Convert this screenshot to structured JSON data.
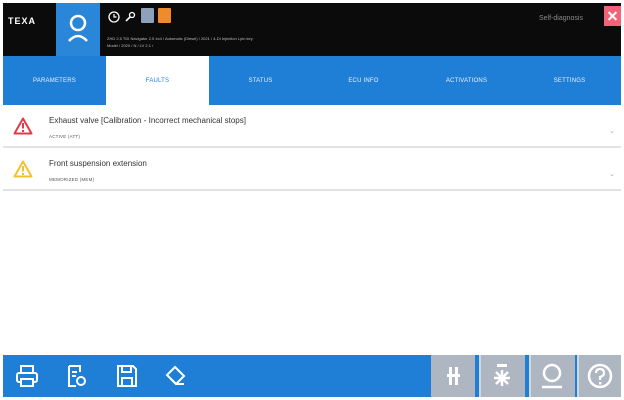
{
  "header": {
    "logo": "TEXA",
    "vehicle_line1": "ZHD 2.5 TDI Navigator 2.5 4x4 / Automatic (Diesel) / 2021 / 4-DI Injection Lpin key",
    "vehicle_line2": "Model / 2020 / N / LV 2.1 /",
    "self_diagnosis": "Self-diagnosis",
    "colors": {
      "bar": "#0b0b0b",
      "accent": "#2a86d9",
      "orange": "#f08a2a",
      "close": "#f2637a"
    }
  },
  "tabs": [
    {
      "label": "PARAMETERS",
      "active": false
    },
    {
      "label": "FAULTS",
      "active": true
    },
    {
      "label": "STATUS",
      "active": false
    },
    {
      "label": "ECU INFO",
      "active": false
    },
    {
      "label": "ACTIVATIONS",
      "active": false
    },
    {
      "label": "SETTINGS",
      "active": false
    }
  ],
  "faults": [
    {
      "title": "Exhaust valve [Calibration - Incorrect mechanical stops]",
      "status": "ACTIVE (ATT)",
      "icon": "warning-red-icon"
    },
    {
      "title": "Front suspension extension",
      "status": "MEMORIZED (MEM)",
      "icon": "warning-yellow-icon"
    }
  ],
  "footer": {
    "left_icons": [
      "print-icon",
      "report-icon",
      "save-icon",
      "eraser-icon"
    ],
    "right_icons": [
      "measure-icon",
      "dtc-icon",
      "user-icon",
      "help-icon"
    ]
  }
}
